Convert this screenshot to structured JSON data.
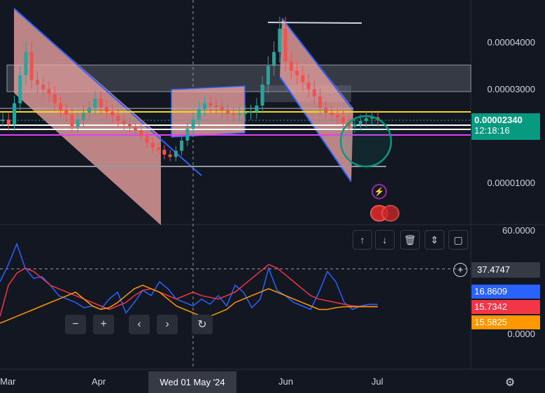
{
  "chart_data": [
    {
      "type": "line",
      "pane": "price",
      "y_ticks": [
        "0.00004000",
        "0.00003000",
        "0.00001000"
      ],
      "y_tick_values": [
        4e-05,
        3e-05,
        1e-05
      ],
      "last_price": "0.00002340",
      "countdown": "12:18:16",
      "x_ticks": [
        "Mar",
        "Apr",
        "Jun",
        "Jul"
      ],
      "crosshair_x_label": "Wed 01 May '24",
      "series": [
        {
          "values": [
            2.35e-05,
            2.25e-05,
            2.7e-05,
            3.3e-05,
            3.8e-05,
            3.2e-05,
            3.1e-05,
            3e-05,
            2.9e-05,
            2.7e-05,
            2.55e-05,
            2.45e-05,
            2.2e-05,
            2.35e-05,
            2.5e-05,
            2.6e-05,
            2.8e-05,
            2.62e-05,
            2.52e-05,
            2.43e-05,
            2.32e-05,
            2.25e-05,
            2.2e-05,
            2.12e-05,
            2e-05,
            1.85e-05,
            1.75e-05,
            1.7e-05,
            1.6e-05,
            1.55e-05,
            1.68e-05,
            1.9e-05,
            2.15e-05,
            2.35e-05,
            2.58e-05,
            2.7e-05,
            2.65e-05,
            2.62e-05,
            2.55e-05,
            2.48e-05,
            2.45e-05,
            2.48e-05,
            2.5e-05,
            2.52e-05,
            2.65e-05,
            3.1e-05,
            3.5e-05,
            3.8e-05,
            4.3e-05,
            3.6e-05,
            3.4e-05,
            3.3e-05,
            3.15e-05,
            3e-05,
            2.85e-05,
            2.6e-05,
            2.5e-05,
            2.45e-05,
            2.4e-05,
            2.28e-05,
            2.2e-05,
            2.25e-05,
            2.32e-05,
            2.38e-05,
            2.4e-05,
            2.34e-05
          ]
        }
      ]
    },
    {
      "type": "line",
      "pane": "indicator",
      "y_ticks": [
        "60.0000",
        "0.0000"
      ],
      "y_tick_values": [
        60,
        0
      ],
      "crosshair_value": "37.4747",
      "crosshair_y": 37.4747,
      "series": [
        {
          "last": "16.8609",
          "color": "#2962ff",
          "values": [
            30,
            40,
            52,
            38,
            32,
            33,
            28,
            22,
            20,
            18,
            15,
            16,
            14,
            20,
            24,
            12,
            18,
            25,
            22,
            30,
            26,
            20,
            18,
            16,
            20,
            17,
            22,
            16,
            28,
            24,
            15,
            20,
            38,
            25,
            22,
            18,
            16,
            14,
            24,
            36,
            30,
            18,
            14,
            16,
            17,
            16.86
          ]
        },
        {
          "last": "15.7342",
          "color": "#f23645",
          "values": [
            10,
            28,
            35,
            38,
            36,
            32,
            28,
            26,
            24,
            22,
            20,
            18,
            16,
            14,
            16,
            18,
            22,
            25,
            26,
            24,
            22,
            20,
            22,
            24,
            22,
            21,
            20,
            22,
            24,
            28,
            32,
            36,
            40,
            38,
            34,
            30,
            26,
            22,
            20,
            19,
            18,
            17,
            16,
            15.73,
            15.73,
            15.73
          ]
        },
        {
          "last": "15.5825",
          "color": "#ff9800",
          "values": [
            6,
            8,
            10,
            12,
            14,
            16,
            18,
            20,
            22,
            24,
            20,
            16,
            14,
            15,
            18,
            22,
            26,
            28,
            26,
            24,
            20,
            16,
            14,
            12,
            10,
            10,
            12,
            14,
            18,
            20,
            22,
            24,
            26,
            24,
            22,
            20,
            18,
            16,
            14,
            14,
            15,
            15.58,
            15.58,
            15.58,
            15.58,
            15.58
          ]
        }
      ]
    }
  ],
  "toolbar": {
    "zoom_out": "−",
    "zoom_in": "+",
    "scroll_left": "‹",
    "scroll_right": "›",
    "reset": "↻"
  },
  "drawing_toolbar": [
    "arrow-up",
    "arrow-down",
    "trash",
    "collapse",
    "fullscreen"
  ],
  "colors": {
    "background": "#131722",
    "channel_fill": "#f7a9a8",
    "channel_line": "#2962ff",
    "yellow_level": "#f5d90a",
    "magenta_level": "#e040fb",
    "up": "#26a69a",
    "down": "#ef5350",
    "last_price_bg": "#089981",
    "blue_tag": "#2962ff",
    "red_tag": "#f23645",
    "orange_tag": "#ff9800"
  },
  "icons": {
    "lightning": "lightning-icon",
    "flag": "us-flag-icon",
    "settings": "settings-icon",
    "crosshair_add": "plus-circle-icon"
  }
}
